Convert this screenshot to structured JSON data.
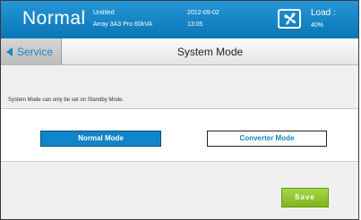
{
  "header": {
    "mode": "Normal",
    "device_name": "Untitled",
    "device_model": "Array 3A3 Pro 60kVA",
    "date": "2012-09-02",
    "time": "13:05",
    "load_label": "Load :",
    "load_value": "40%",
    "fan_icon": "fan-icon"
  },
  "nav": {
    "back_label": "Service",
    "title": "System Mode"
  },
  "content": {
    "notice": "System Mode can only be set on Standby Mode.",
    "normal_mode_label": "Normal Mode",
    "converter_mode_label": "Converter Mode",
    "selected_mode": "Normal Mode",
    "save_label": "Save"
  },
  "colors": {
    "header_blue": "#0a76b6",
    "accent_blue": "#1185c9",
    "save_green": "#7cb51b"
  }
}
